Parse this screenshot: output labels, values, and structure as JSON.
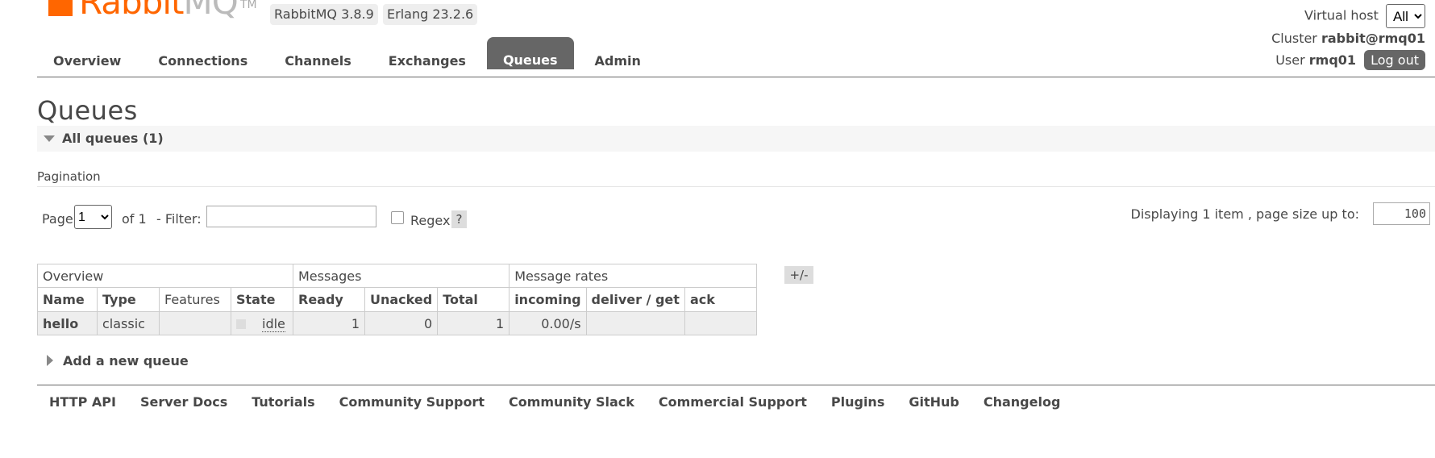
{
  "header": {
    "logo_word_1": "Rabbit",
    "logo_word_2": "MQ",
    "logo_tm": "TM",
    "version_rabbitmq": "RabbitMQ 3.8.9",
    "version_erlang": "Erlang 23.2.6",
    "virtual_host_label": "Virtual host",
    "virtual_host_value": "All",
    "cluster_label": "Cluster",
    "cluster_value": "rabbit@rmq01",
    "user_label": "User",
    "user_value": "rmq01",
    "logout_label": "Log out"
  },
  "tabs": [
    {
      "label": "Overview"
    },
    {
      "label": "Connections"
    },
    {
      "label": "Channels"
    },
    {
      "label": "Exchanges"
    },
    {
      "label": "Queues",
      "active": true
    },
    {
      "label": "Admin"
    }
  ],
  "main": {
    "title": "Queues",
    "section_label": "All queues (1)",
    "pagination_label": "Pagination",
    "page_label": "Page",
    "page_value": "1",
    "of_label": "of 1",
    "filter_label": "- Filter:",
    "filter_value": "",
    "regex_label": "Regex",
    "help_label": "?",
    "displaying_label": "Displaying 1 item , page size up to:",
    "page_size_value": "100",
    "plus_minus_label": "+/-",
    "add_queue_label": "Add a new queue"
  },
  "table": {
    "groups": [
      "Overview",
      "Messages",
      "Message rates"
    ],
    "columns": [
      "Name",
      "Type",
      "Features",
      "State",
      "Ready",
      "Unacked",
      "Total",
      "incoming",
      "deliver / get",
      "ack"
    ],
    "rows": [
      {
        "name": "hello",
        "type": "classic",
        "features": "",
        "state": "idle",
        "ready": "1",
        "unacked": "0",
        "total": "1",
        "incoming": "0.00/s",
        "deliver_get": "",
        "ack": ""
      }
    ]
  },
  "footer": {
    "links": [
      "HTTP API",
      "Server Docs",
      "Tutorials",
      "Community Support",
      "Community Slack",
      "Commercial Support",
      "Plugins",
      "GitHub",
      "Changelog"
    ]
  },
  "colors": {
    "brand_orange": "#ff6600",
    "active_tab": "#666666"
  }
}
